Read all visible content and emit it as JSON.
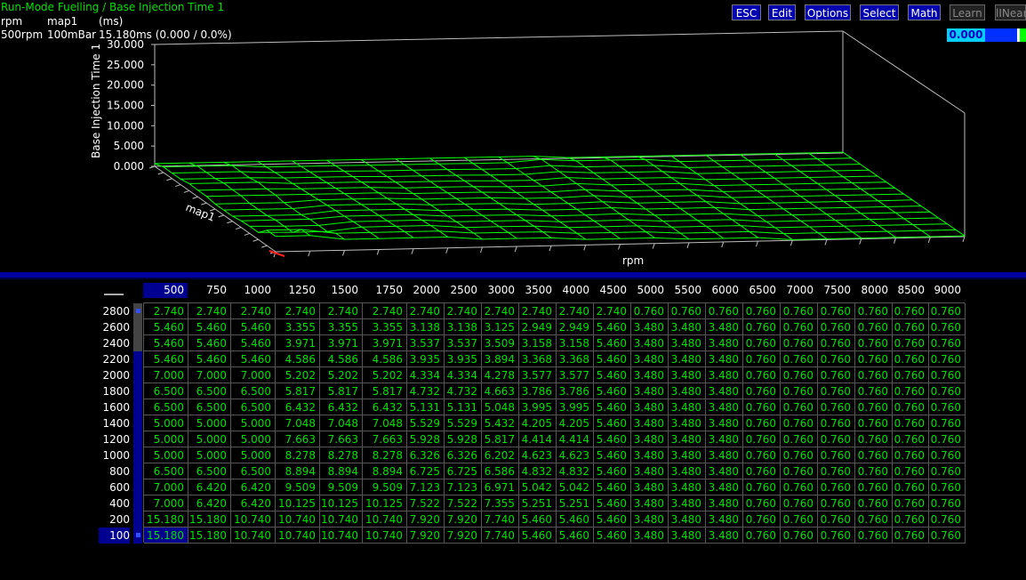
{
  "title": "Run-Mode Fuelling / Base Injection Time 1",
  "info": {
    "x_axis": "rpm",
    "y_axis": "map1",
    "unit": "(ms)",
    "cursor_rpm": "500rpm",
    "cursor_map": "100mBar",
    "cursor_value": "15.180ms (0.000 / 0.0%)"
  },
  "toolbar": {
    "esc": "ESC",
    "edit": "Edit",
    "options": "Options",
    "select": "Select",
    "math": "Math",
    "learn": "Learn",
    "linear": "lINear"
  },
  "legend": {
    "value": "0.000"
  },
  "plot": {
    "z_label": "Base Injection Time 1",
    "x_label": "rpm",
    "y_label": "map1",
    "z_ticks": [
      "30.000",
      "25.000",
      "20.000",
      "15.000",
      "10.000",
      "5.000",
      "0.000"
    ]
  },
  "table": {
    "col_headers": [
      "500",
      "750",
      "1000",
      "1250",
      "1500",
      "1750",
      "2000",
      "2500",
      "3000",
      "3500",
      "4000",
      "4500",
      "5000",
      "5500",
      "6000",
      "6500",
      "7000",
      "7500",
      "8000",
      "8500",
      "9000"
    ],
    "row_headers": [
      "2800",
      "2600",
      "2400",
      "2200",
      "2000",
      "1800",
      "1600",
      "1400",
      "1200",
      "1000",
      "800",
      "600",
      "400",
      "200",
      "100"
    ],
    "rows": [
      [
        "2.740",
        "2.740",
        "2.740",
        "2.740",
        "2.740",
        "2.740",
        "2.740",
        "2.740",
        "2.740",
        "2.740",
        "2.740",
        "2.740",
        "0.760",
        "0.760",
        "0.760",
        "0.760",
        "0.760",
        "0.760",
        "0.760",
        "0.760",
        "0.760"
      ],
      [
        "5.460",
        "5.460",
        "5.460",
        "3.355",
        "3.355",
        "3.355",
        "3.138",
        "3.138",
        "3.125",
        "2.949",
        "2.949",
        "5.460",
        "3.480",
        "3.480",
        "3.480",
        "0.760",
        "0.760",
        "0.760",
        "0.760",
        "0.760",
        "0.760"
      ],
      [
        "5.460",
        "5.460",
        "5.460",
        "3.971",
        "3.971",
        "3.971",
        "3.537",
        "3.537",
        "3.509",
        "3.158",
        "3.158",
        "5.460",
        "3.480",
        "3.480",
        "3.480",
        "0.760",
        "0.760",
        "0.760",
        "0.760",
        "0.760",
        "0.760"
      ],
      [
        "5.460",
        "5.460",
        "5.460",
        "4.586",
        "4.586",
        "4.586",
        "3.935",
        "3.935",
        "3.894",
        "3.368",
        "3.368",
        "5.460",
        "3.480",
        "3.480",
        "3.480",
        "0.760",
        "0.760",
        "0.760",
        "0.760",
        "0.760",
        "0.760"
      ],
      [
        "7.000",
        "7.000",
        "7.000",
        "5.202",
        "5.202",
        "5.202",
        "4.334",
        "4.334",
        "4.278",
        "3.577",
        "3.577",
        "5.460",
        "3.480",
        "3.480",
        "3.480",
        "0.760",
        "0.760",
        "0.760",
        "0.760",
        "0.760",
        "0.760"
      ],
      [
        "6.500",
        "6.500",
        "6.500",
        "5.817",
        "5.817",
        "5.817",
        "4.732",
        "4.732",
        "4.663",
        "3.786",
        "3.786",
        "5.460",
        "3.480",
        "3.480",
        "3.480",
        "0.760",
        "0.760",
        "0.760",
        "0.760",
        "0.760",
        "0.760"
      ],
      [
        "6.500",
        "6.500",
        "6.500",
        "6.432",
        "6.432",
        "6.432",
        "5.131",
        "5.131",
        "5.048",
        "3.995",
        "3.995",
        "5.460",
        "3.480",
        "3.480",
        "3.480",
        "0.760",
        "0.760",
        "0.760",
        "0.760",
        "0.760",
        "0.760"
      ],
      [
        "5.000",
        "5.000",
        "5.000",
        "7.048",
        "7.048",
        "7.048",
        "5.529",
        "5.529",
        "5.432",
        "4.205",
        "4.205",
        "5.460",
        "3.480",
        "3.480",
        "3.480",
        "0.760",
        "0.760",
        "0.760",
        "0.760",
        "0.760",
        "0.760"
      ],
      [
        "5.000",
        "5.000",
        "5.000",
        "7.663",
        "7.663",
        "7.663",
        "5.928",
        "5.928",
        "5.817",
        "4.414",
        "4.414",
        "5.460",
        "3.480",
        "3.480",
        "3.480",
        "0.760",
        "0.760",
        "0.760",
        "0.760",
        "0.760",
        "0.760"
      ],
      [
        "5.000",
        "5.000",
        "5.000",
        "8.278",
        "8.278",
        "8.278",
        "6.326",
        "6.326",
        "6.202",
        "4.623",
        "4.623",
        "5.460",
        "3.480",
        "3.480",
        "3.480",
        "0.760",
        "0.760",
        "0.760",
        "0.760",
        "0.760",
        "0.760"
      ],
      [
        "6.500",
        "6.500",
        "6.500",
        "8.894",
        "8.894",
        "8.894",
        "6.725",
        "6.725",
        "6.586",
        "4.832",
        "4.832",
        "5.460",
        "3.480",
        "3.480",
        "3.480",
        "0.760",
        "0.760",
        "0.760",
        "0.760",
        "0.760",
        "0.760"
      ],
      [
        "7.000",
        "6.420",
        "6.420",
        "9.509",
        "9.509",
        "9.509",
        "7.123",
        "7.123",
        "6.971",
        "5.042",
        "5.042",
        "5.460",
        "3.480",
        "3.480",
        "3.480",
        "0.760",
        "0.760",
        "0.760",
        "0.760",
        "0.760",
        "0.760"
      ],
      [
        "7.000",
        "6.420",
        "6.420",
        "10.125",
        "10.125",
        "10.125",
        "7.522",
        "7.522",
        "7.355",
        "5.251",
        "5.251",
        "5.460",
        "3.480",
        "3.480",
        "3.480",
        "0.760",
        "0.760",
        "0.760",
        "0.760",
        "0.760",
        "0.760"
      ],
      [
        "15.180",
        "15.180",
        "10.740",
        "10.740",
        "10.740",
        "10.740",
        "7.920",
        "7.920",
        "7.740",
        "5.460",
        "5.460",
        "5.460",
        "3.480",
        "3.480",
        "3.480",
        "0.760",
        "0.760",
        "0.760",
        "0.760",
        "0.760",
        "0.760"
      ],
      [
        "15.180",
        "15.180",
        "10.740",
        "10.740",
        "10.740",
        "10.740",
        "7.920",
        "7.920",
        "7.740",
        "5.460",
        "5.460",
        "5.460",
        "3.480",
        "3.480",
        "3.480",
        "0.760",
        "0.760",
        "0.760",
        "0.760",
        "0.760",
        "0.760"
      ]
    ],
    "selected_row": 14,
    "selected_col": 0
  },
  "colors": {
    "background": "#000000",
    "mesh": "#00ff00",
    "cell_text": "#00e000",
    "selection": "#000090",
    "toolbar_button": "#0000b0",
    "divider": "#0000a0"
  }
}
